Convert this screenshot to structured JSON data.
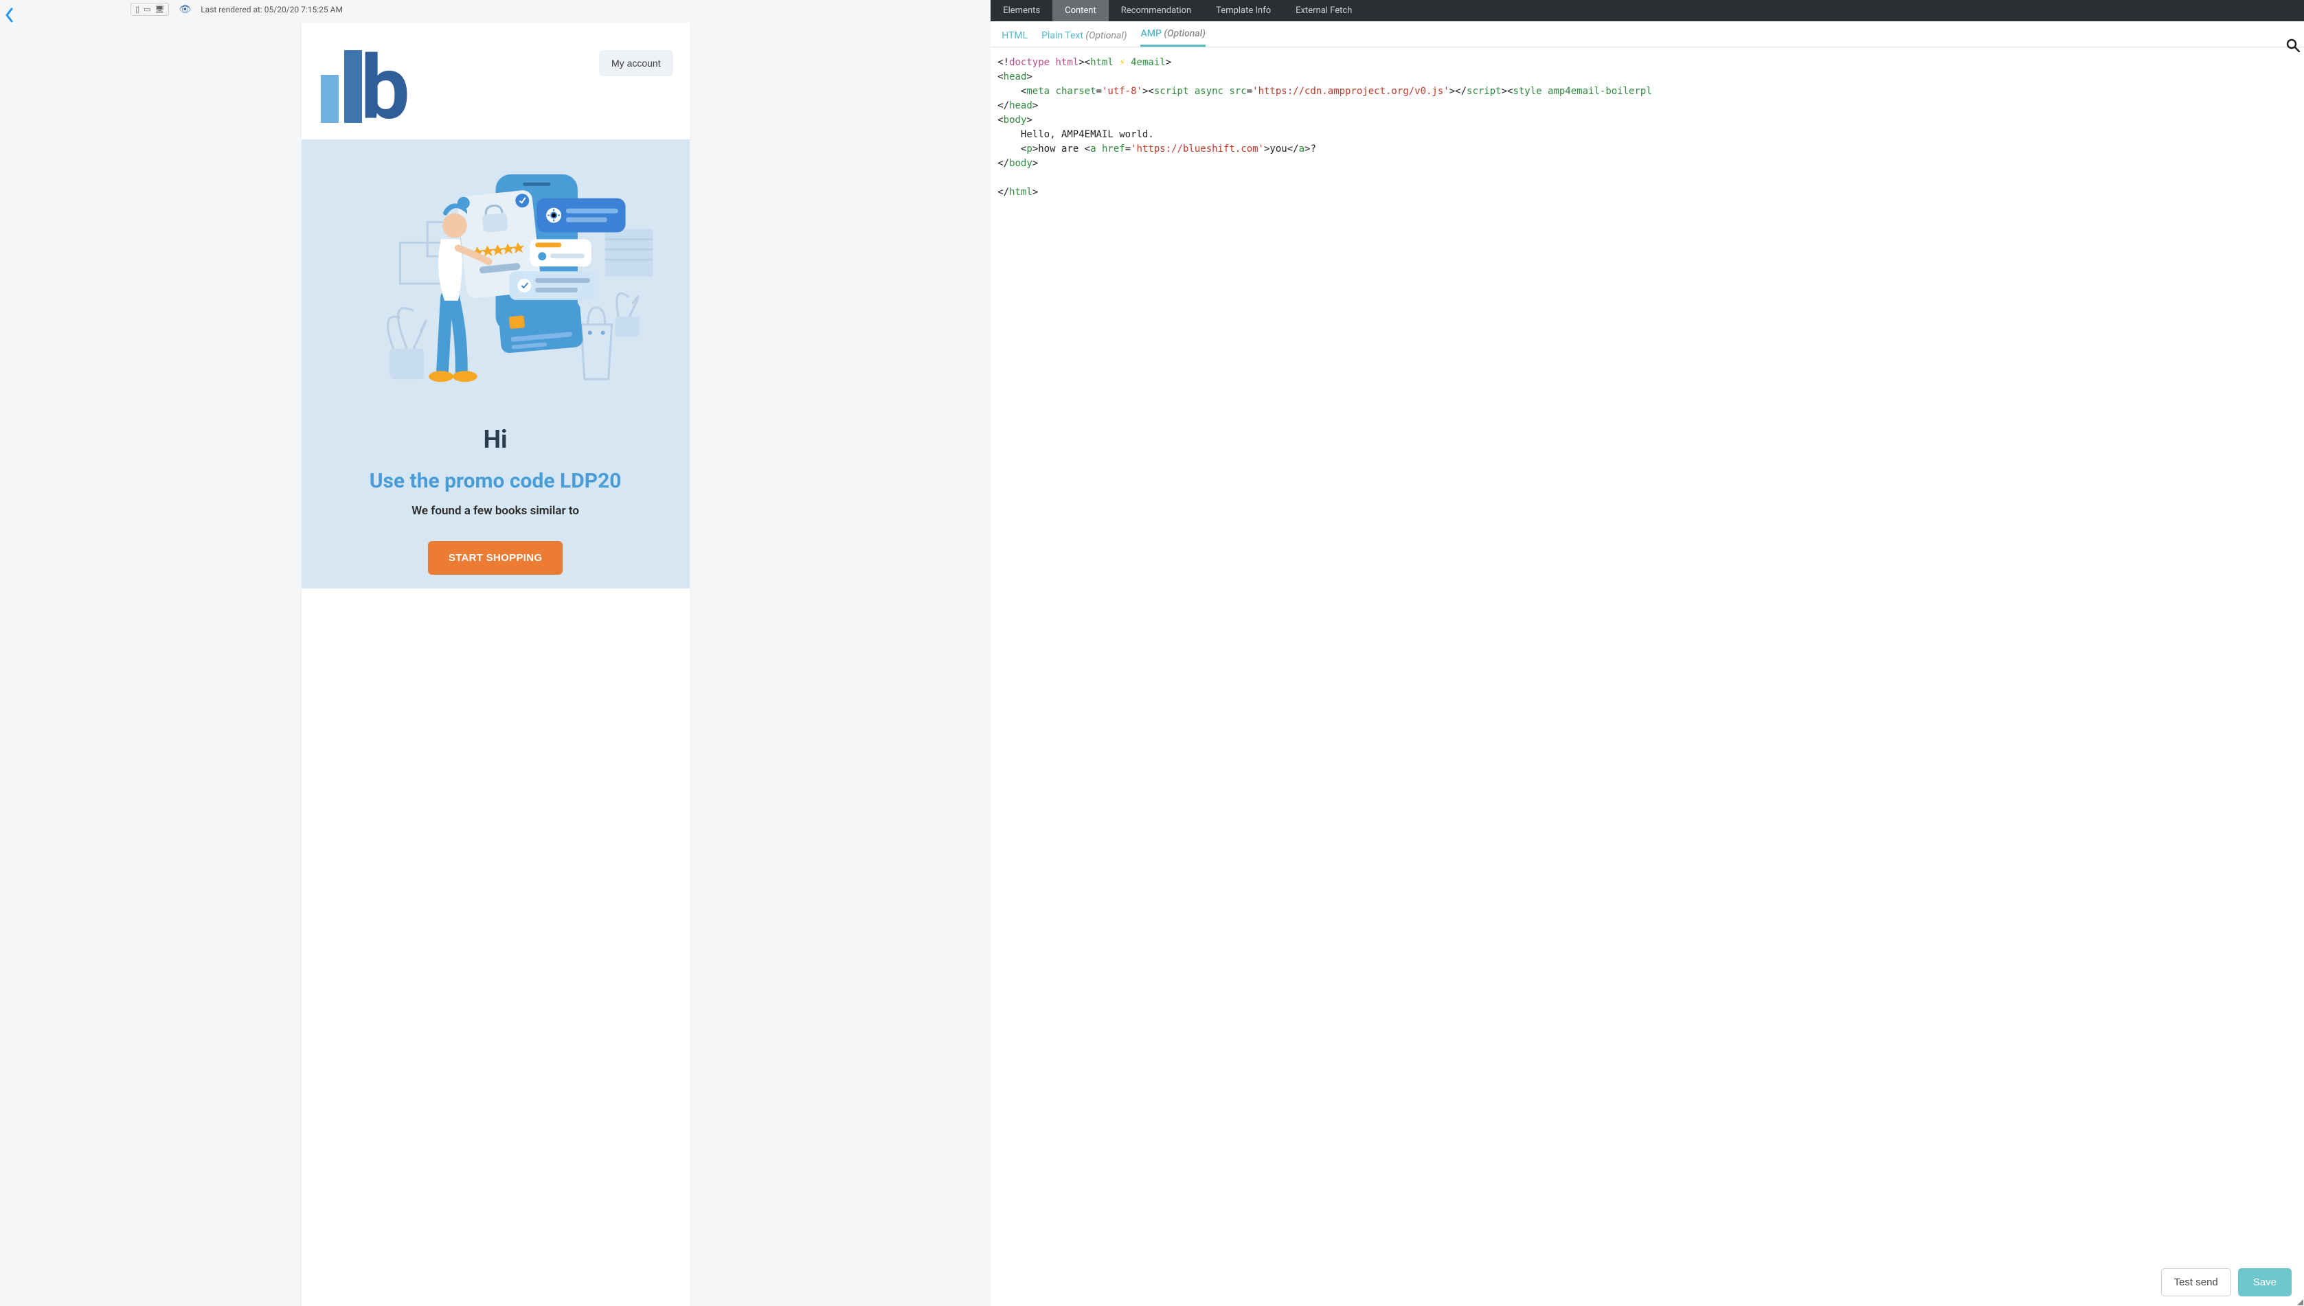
{
  "top": {
    "rendered_label": "Last rendered at: 05/20/20 7:15:25 AM"
  },
  "email": {
    "my_account": "My account",
    "hi": "Hi",
    "promo": "Use the promo code LDP20",
    "books": "We found a few books similar to",
    "cta": "START SHOPPING"
  },
  "tabs_primary": [
    {
      "label": "Elements"
    },
    {
      "label": "Content"
    },
    {
      "label": "Recommendation"
    },
    {
      "label": "Template Info"
    },
    {
      "label": "External Fetch"
    }
  ],
  "tabs_primary_active": 1,
  "tabs_secondary": [
    {
      "label": "HTML",
      "optional": ""
    },
    {
      "label": "Plain Text",
      "optional": "(Optional)"
    },
    {
      "label": "AMP",
      "optional": "(Optional)"
    }
  ],
  "tabs_secondary_active": 2,
  "code": {
    "line1_a": "<!",
    "line1_b": "doctype html",
    "line1_c": "><",
    "line1_d": "html",
    "line1_e": " ",
    "line1_bolt": "⚡",
    "line1_f": " 4email",
    "line1_g": ">",
    "line2_a": "<",
    "line2_b": "head",
    "line2_c": ">",
    "line3_a": "    <",
    "line3_b": "meta charset",
    "line3_c": "=",
    "line3_d": "'utf-8'",
    "line3_e": "><",
    "line3_f": "script async src",
    "line3_g": "=",
    "line3_h": "'https://cdn.ampproject.org/v0.js'",
    "line3_i": "></",
    "line3_j": "script",
    "line3_k": "><",
    "line3_l": "style amp4email-boilerpl",
    "line4_a": "</",
    "line4_b": "head",
    "line4_c": ">",
    "line5_a": "<",
    "line5_b": "body",
    "line5_c": ">",
    "line6": "    Hello, AMP4EMAIL world.",
    "line7_a": "    <",
    "line7_b": "p",
    "line7_c": ">how are <",
    "line7_d": "a href",
    "line7_e": "=",
    "line7_f": "'https://blueshift.com'",
    "line7_g": ">you</",
    "line7_h": "a",
    "line7_i": ">?",
    "line8_a": "</",
    "line8_b": "body",
    "line8_c": ">",
    "line9": "",
    "line10_a": "</",
    "line10_b": "html",
    "line10_c": ">"
  },
  "footer": {
    "test_send": "Test send",
    "save": "Save"
  }
}
